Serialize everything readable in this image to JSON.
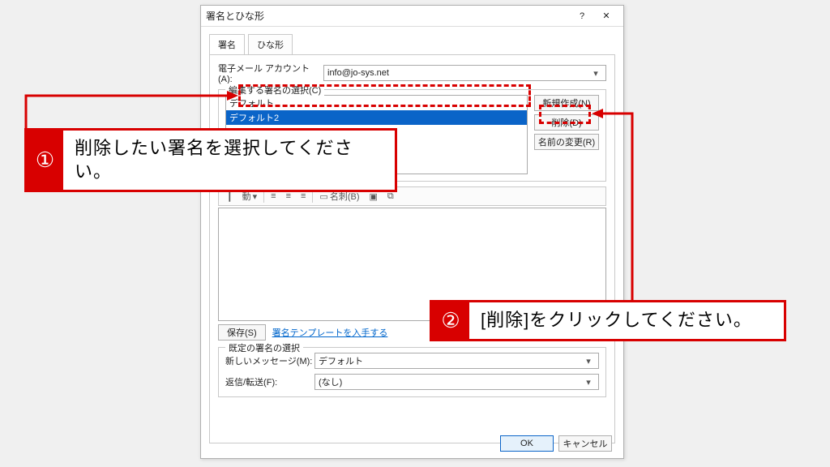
{
  "dialog": {
    "title": "署名とひな形",
    "help_icon": "?",
    "close_icon": "✕"
  },
  "tabs": {
    "active": "署名",
    "inactive": "ひな形"
  },
  "account": {
    "label": "電子メール アカウント(A):",
    "value": "info@jo-sys.net"
  },
  "edit_group": {
    "legend": "編集する署名の選択(C)",
    "items": [
      "デフォルト",
      "デフォルト2"
    ],
    "selected_index": 1,
    "buttons": {
      "new": "新規作成(N)",
      "delete": "削除(D)",
      "rename": "名前の変更(R)"
    }
  },
  "toolbar": {
    "move_label": "動",
    "card_label": "名刺(B)"
  },
  "savebar": {
    "save": "保存(S)",
    "get_templates": "署名テンプレートを入手する"
  },
  "default_group": {
    "legend": "既定の署名の選択",
    "new_msg_label": "新しいメッセージ(M):",
    "new_msg_value": "デフォルト",
    "reply_label": "返信/転送(F):",
    "reply_value": "(なし)"
  },
  "footer": {
    "ok": "OK",
    "cancel": "キャンセル"
  },
  "callouts": {
    "c1": {
      "num": "①",
      "text": "削除したい署名を選択してください。"
    },
    "c2": {
      "num": "②",
      "text": "[削除]をクリックしてください。"
    }
  }
}
